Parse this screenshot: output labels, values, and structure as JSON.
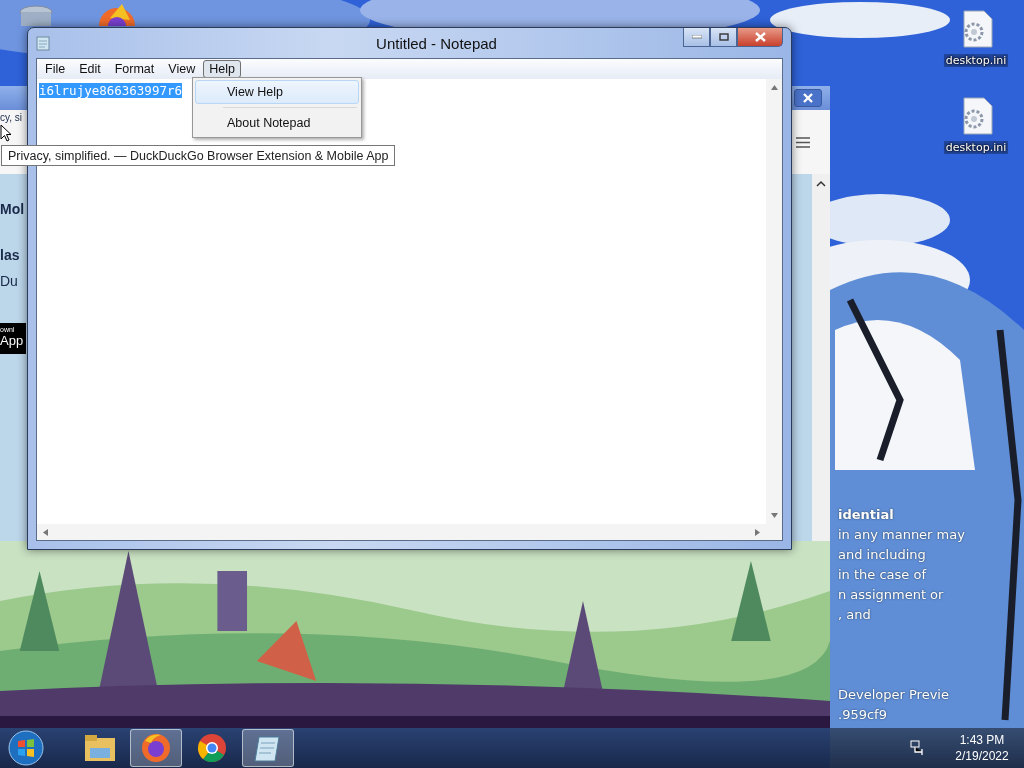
{
  "desktop": {
    "icons": [
      {
        "label": "desktop.ini"
      },
      {
        "label": "desktop.ini"
      }
    ],
    "watermark_lines": [
      "idential",
      "in any manner may",
      "and including",
      "in the case of",
      "n assignment or",
      ", and",
      "Developer Previe",
      ".959cf9"
    ]
  },
  "browser": {
    "page_fragments": [
      "cy, si",
      "Mol",
      "las",
      "Du",
      "ownl",
      "App"
    ],
    "tooltip": "Privacy, simplified. — DuckDuckGo Browser Extension & Mobile App"
  },
  "notepad": {
    "title": "Untitled - Notepad",
    "menu": [
      {
        "label": "File",
        "selected": false
      },
      {
        "label": "Edit",
        "selected": false
      },
      {
        "label": "Format",
        "selected": false
      },
      {
        "label": "View",
        "selected": false
      },
      {
        "label": "Help",
        "selected": true
      }
    ],
    "text": "i6lrujye866363997r6",
    "text_selected": true,
    "help_menu": [
      {
        "label": "View Help",
        "selected": true
      },
      {
        "label": "About Notepad",
        "selected": false
      }
    ]
  },
  "taskbar": {
    "items": [
      {
        "kind": "explorer",
        "active": false
      },
      {
        "kind": "firefox",
        "active": true
      },
      {
        "kind": "chrome",
        "active": false
      },
      {
        "kind": "notepad",
        "active": true
      }
    ],
    "time": "1:43 PM",
    "date": "2/19/2022"
  }
}
